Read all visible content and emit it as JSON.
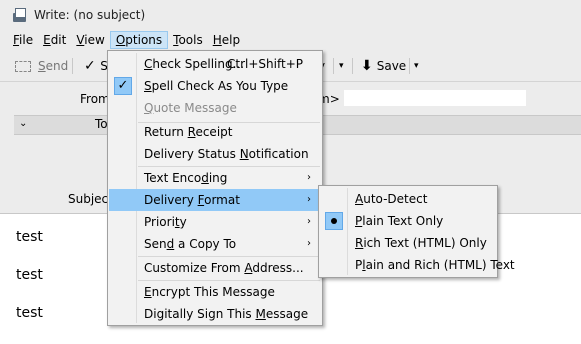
{
  "window": {
    "title": "Write: (no subject)"
  },
  "menubar": [
    {
      "label": "File",
      "key": "F",
      "rest": "ile"
    },
    {
      "label": "Edit",
      "key": "E",
      "rest": "dit"
    },
    {
      "label": "View",
      "key": "V",
      "rest": "iew"
    },
    {
      "label": "Options",
      "key": "O",
      "rest": "ptions"
    },
    {
      "label": "Tools",
      "key": "T",
      "rest": "ools"
    },
    {
      "label": "Help",
      "key": "H",
      "rest": "elp"
    }
  ],
  "toolbar": {
    "send_label": "Send",
    "send_key": "S",
    "send_rest": "end",
    "spell_frag": "S",
    "save_label": "Save"
  },
  "headers": {
    "from_label": "From",
    "from_value_fragment": "m>",
    "to_label": "To",
    "subject_label": "Subject"
  },
  "body": {
    "lines": [
      "test",
      "test",
      "test"
    ]
  },
  "options_menu": {
    "check_spelling": {
      "pre": "",
      "key": "C",
      "post": "heck Spelling...",
      "accel": "Ctrl+Shift+P"
    },
    "spell_as_type": {
      "pre": "",
      "key": "S",
      "post": "pell Check As You Type",
      "checked_glyph": "✓"
    },
    "quote_message": {
      "pre": "",
      "key": "Q",
      "post": "uote Message"
    },
    "return_receipt": {
      "pre": "Return ",
      "key": "R",
      "post": "eceipt"
    },
    "delivery_status": {
      "pre": "Delivery Status ",
      "key": "N",
      "post": "otification"
    },
    "text_encoding": {
      "pre": "Text Enco",
      "key": "d",
      "post": "ing"
    },
    "delivery_format": {
      "pre": "Delivery ",
      "key": "F",
      "post": "ormat"
    },
    "priority": {
      "pre": "Priori",
      "key": "t",
      "post": "y"
    },
    "send_copy_to": {
      "pre": "Sen",
      "key": "d",
      "post": " a Copy To"
    },
    "customize_from": {
      "pre": "Customize From ",
      "key": "A",
      "post": "ddress..."
    },
    "encrypt": {
      "pre": "",
      "key": "E",
      "post": "ncrypt This Message"
    },
    "sign": {
      "pre": "Digitally Sign This ",
      "key": "M",
      "post": "essage"
    }
  },
  "format_menu": {
    "auto_detect": {
      "pre": "",
      "key": "A",
      "post": "uto-Detect"
    },
    "plain_text": {
      "pre": "",
      "key": "P",
      "post": "lain Text Only"
    },
    "rich_text": {
      "pre": "",
      "key": "R",
      "post": "ich Text (HTML) Only"
    },
    "plain_and_rich": {
      "pre": "P",
      "key": "l",
      "post": "ain and Rich (HTML) Text"
    }
  },
  "glyphs": {
    "submenu_arrow": "›",
    "dropdown_caret": "▾",
    "save_arrow": "⬇",
    "chevron_down": "⌄"
  }
}
